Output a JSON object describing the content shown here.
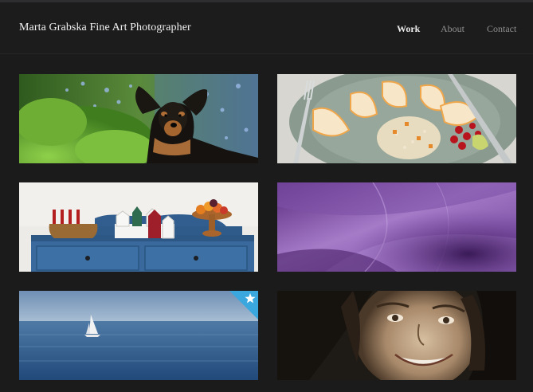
{
  "site": {
    "title": "Marta Grabska Fine Art Photographer"
  },
  "nav": {
    "items": [
      {
        "label": "Work",
        "active": true
      },
      {
        "label": "About",
        "active": false
      },
      {
        "label": "Contact",
        "active": false
      }
    ]
  },
  "gallery": {
    "tiles": [
      {
        "subject": "dachshund in flowers"
      },
      {
        "subject": "plate with tangerine slices, rice and berries"
      },
      {
        "subject": "blue dresser with candles and toy houses"
      },
      {
        "subject": "purple flower petal macro"
      },
      {
        "subject": "sailboat on calm sea",
        "featured": true
      },
      {
        "subject": "smiling woman portrait"
      }
    ]
  },
  "colors": {
    "background": "#1b1b1c",
    "title_text": "#f1f1f1",
    "nav_active": "#ececec",
    "nav_inactive": "#8f8f8f",
    "featured_badge": "#3aa7df"
  },
  "icons": {
    "featured": "star-icon"
  }
}
